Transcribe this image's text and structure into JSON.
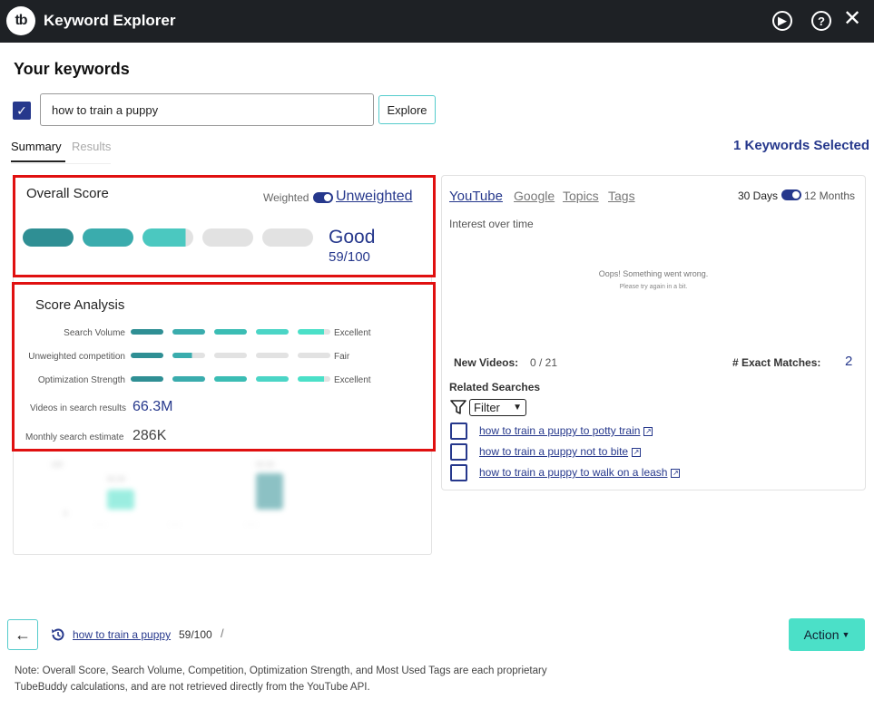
{
  "app": {
    "logo_text": "tb",
    "title": "Keyword Explorer"
  },
  "icons": {
    "play": "play-circle-icon",
    "help": "help-circle-icon",
    "close": "close-icon",
    "filter": "filter-icon",
    "history": "history-icon",
    "back": "arrow-left-icon",
    "external": "external-link-icon"
  },
  "colors": {
    "accent": "#26388c",
    "teal_dark": "#2f8f94",
    "teal": "#3aacad",
    "teal_light": "#4bc8c0",
    "teal_bright": "#4be0c8",
    "highlight_red": "#e01010",
    "empty": "#e2e2e2"
  },
  "header": {
    "your_keywords": "Your keywords"
  },
  "search": {
    "value": "how to train a puppy",
    "explore_label": "Explore"
  },
  "tabs": {
    "summary": "Summary",
    "results": "Results"
  },
  "keywords_selected": "1 Keywords Selected",
  "overall": {
    "title": "Overall Score",
    "weighted": "Weighted",
    "unweighted": "Unweighted",
    "rating": "Good",
    "score": "59/100",
    "filled_segments": 3,
    "total_segments": 5
  },
  "analysis": {
    "title": "Score Analysis",
    "rows": [
      {
        "label": "Search Volume",
        "level": "Excellent",
        "fill": 4.8
      },
      {
        "label": "Unweighted competition",
        "level": "Fair",
        "fill": 1.6
      },
      {
        "label": "Optimization Strength",
        "level": "Excellent",
        "fill": 4.8
      }
    ],
    "videos_label": "Videos in search results",
    "videos_value": "66.3M",
    "monthly_label": "Monthly search estimate",
    "monthly_value": "286K"
  },
  "right": {
    "tabs": [
      "YouTube",
      "Google",
      "Topics",
      "Tags"
    ],
    "range_30": "30 Days",
    "range_12": "12 Months",
    "interest_title": "Interest over time",
    "error_title": "Oops! Something went wrong.",
    "error_sub": "Please try again in a bit.",
    "new_videos_label": "New Videos:",
    "new_videos_value": "0 / 21",
    "exact_label": "# Exact Matches:",
    "exact_value": "2",
    "related_title": "Related Searches",
    "filter_label": "Filter",
    "related": [
      "how to train a puppy to potty train",
      "how to train a puppy not to bite",
      "how to train a puppy to walk on a leash"
    ]
  },
  "footer": {
    "history_link": "how to train a puppy",
    "history_score": "59/100",
    "separator": "/",
    "action_label": "Action",
    "note": "Note: Overall Score, Search Volume, Competition, Optimization Strength, and Most Used Tags are each proprietary TubeBuddy calculations, and are not retrieved directly from the YouTube API."
  }
}
